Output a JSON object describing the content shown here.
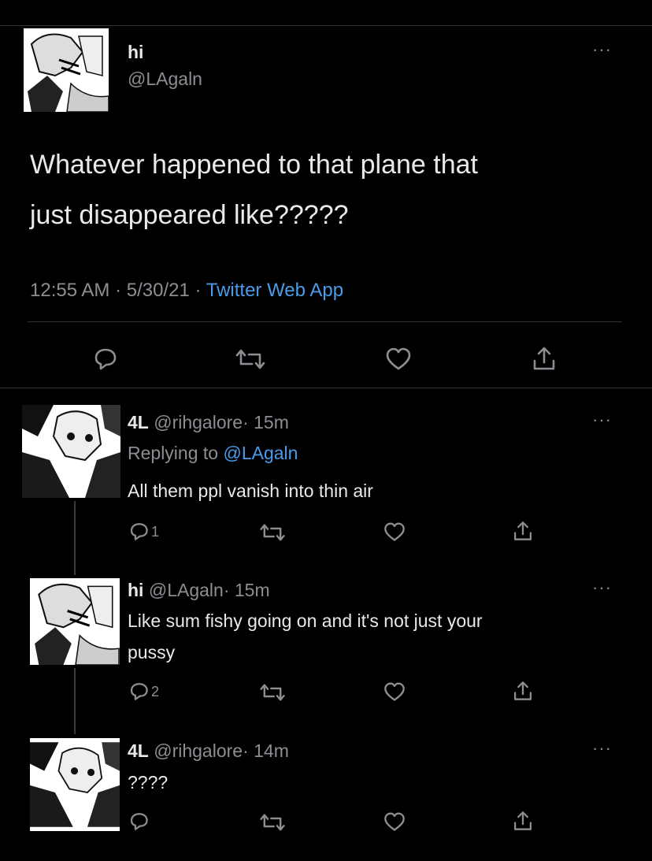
{
  "main_tweet": {
    "display_name": "hi",
    "handle": "@LAgaln",
    "text_line1": "Whatever happened to that plane that",
    "text_line2": "just disappeared like?????",
    "time": "12:55 AM",
    "date": "5/30/21",
    "source": "Twitter Web App",
    "sep": "·",
    "more": "···"
  },
  "replies": [
    {
      "display_name": "4L",
      "handle": "@rihgalore",
      "age": "15m",
      "replying_prefix": "Replying to",
      "replying_handle": "@LAgaln",
      "text": "All them ppl vanish into thin air",
      "reply_count": "1"
    },
    {
      "display_name": "hi",
      "handle": "@LAgaln",
      "age": "15m",
      "text_line1": "Like sum fishy going on and it's not just your",
      "text_line2": "pussy",
      "reply_count": "2"
    },
    {
      "display_name": "4L",
      "handle": "@rihgalore",
      "age": "14m",
      "text": "????"
    }
  ],
  "icons": {
    "reply": "reply-icon",
    "retweet": "retweet-icon",
    "like": "like-icon",
    "share": "share-icon",
    "more": "more-icon"
  },
  "colors": {
    "background": "#000000",
    "text": "#e7e9ea",
    "secondary": "#8b8f93",
    "link": "#4a9ce8"
  }
}
